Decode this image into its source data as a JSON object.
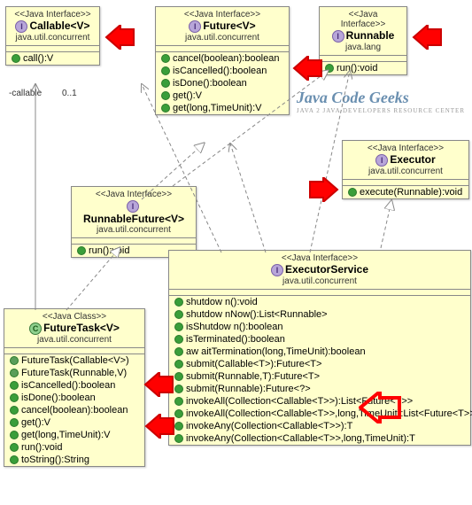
{
  "classes": {
    "callable": {
      "stereo": "<<Java Interface>>",
      "name": "Callable<V>",
      "pkg": "java.util.concurrent",
      "ops": [
        "call():V"
      ]
    },
    "future": {
      "stereo": "<<Java Interface>>",
      "name": "Future<V>",
      "pkg": "java.util.concurrent",
      "ops": [
        "cancel(boolean):boolean",
        "isCancelled():boolean",
        "isDone():boolean",
        "get():V",
        "get(long,TimeUnit):V"
      ]
    },
    "runnable": {
      "stereo": "<<Java Interface>>",
      "name": "Runnable",
      "pkg": "java.lang",
      "ops": [
        "run():void"
      ]
    },
    "executor": {
      "stereo": "<<Java Interface>>",
      "name": "Executor",
      "pkg": "java.util.concurrent",
      "ops": [
        "execute(Runnable):void"
      ]
    },
    "runnablefuture": {
      "stereo": "<<Java Interface>>",
      "name": "RunnableFuture<V>",
      "pkg": "java.util.concurrent",
      "ops": [
        "run():void"
      ]
    },
    "executorservice": {
      "stereo": "<<Java Interface>>",
      "name": "ExecutorService",
      "pkg": "java.util.concurrent",
      "ops": [
        "shutdow n():void",
        "shutdow nNow():List<Runnable>",
        "isShutdow n():boolean",
        "isTerminated():boolean",
        "aw aitTermination(long,TimeUnit):boolean",
        "submit(Callable<T>):Future<T>",
        "submit(Runnable,T):Future<T>",
        "submit(Runnable):Future<?>",
        "invokeAll(Collection<Callable<T>>):List<Future<T>>",
        "invokeAll(Collection<Callable<T>>,long,TimeUnit):List<Future<T>>",
        "invokeAny(Collection<Callable<T>>):T",
        "invokeAny(Collection<Callable<T>>,long,TimeUnit):T"
      ]
    },
    "futuretask": {
      "stereo": "<<Java Class>>",
      "name": "FutureTask<V>",
      "pkg": "java.util.concurrent",
      "ctors": [
        "FutureTask(Callable<V>)",
        "FutureTask(Runnable,V)"
      ],
      "ops": [
        "isCancelled():boolean",
        "isDone():boolean",
        "cancel(boolean):boolean",
        "get():V",
        "get(long,TimeUnit):V",
        "run():void",
        "toString():String"
      ]
    }
  },
  "labels": {
    "callable": "-callable",
    "mult": "0..1"
  },
  "logo": {
    "line1": "Java Code Geeks",
    "line2": "JAVA 2 JAVA DEVELOPERS RESOURCE CENTER"
  }
}
